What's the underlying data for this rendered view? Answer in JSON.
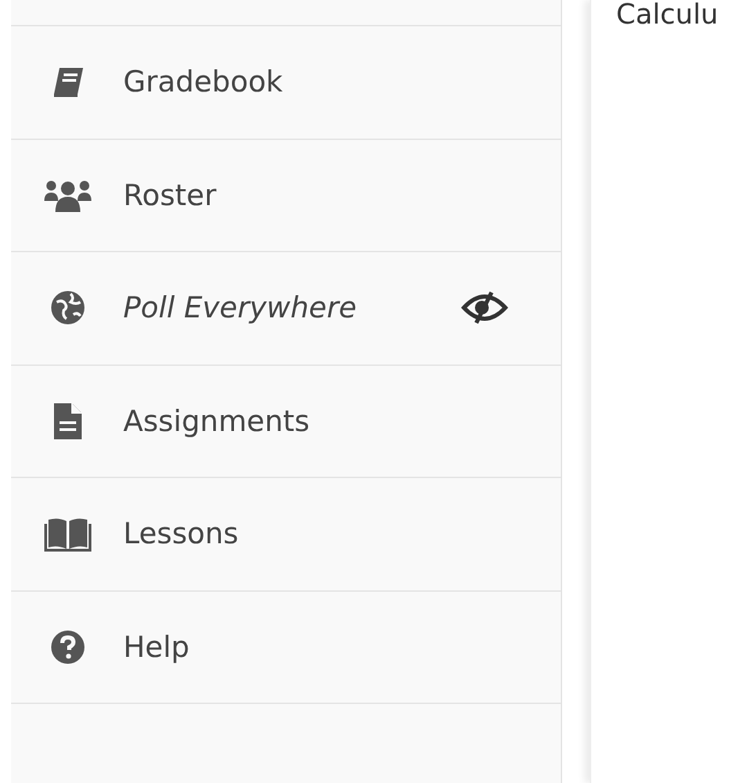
{
  "sidebar": {
    "items": [
      {
        "label": "Gradebook",
        "hidden": false
      },
      {
        "label": "Roster",
        "hidden": false
      },
      {
        "label": "Poll Everywhere",
        "hidden": true
      },
      {
        "label": "Assignments",
        "hidden": false
      },
      {
        "label": "Lessons",
        "hidden": false
      },
      {
        "label": "Help",
        "hidden": false
      }
    ]
  },
  "content": {
    "heading": "Calculu"
  }
}
